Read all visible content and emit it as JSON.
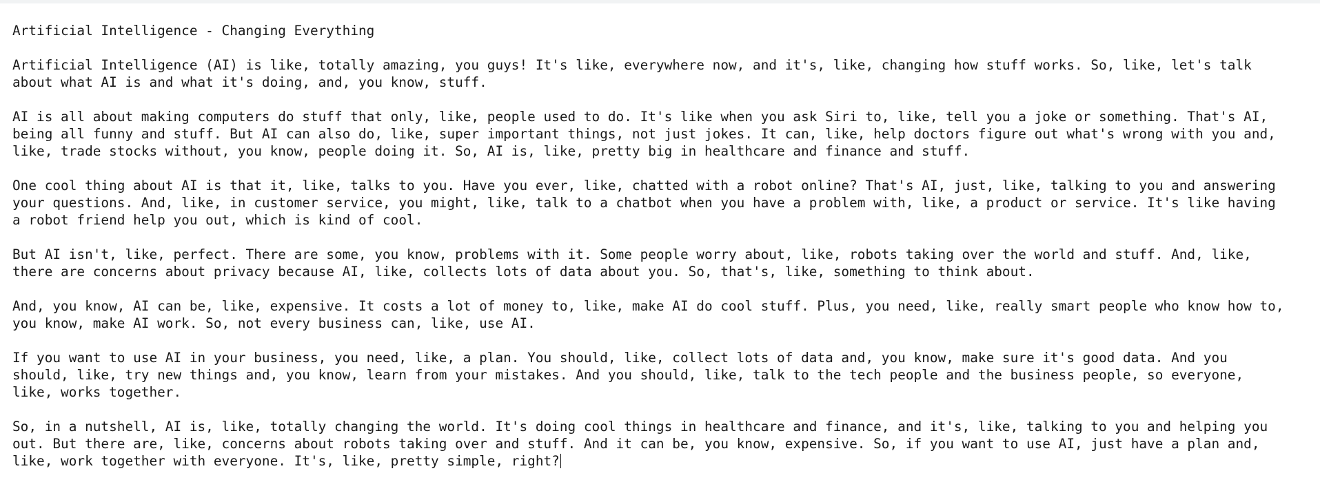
{
  "document": {
    "lines": [
      "Artificial Intelligence - Changing Everything",
      "",
      "Artificial Intelligence (AI) is like, totally amazing, you guys! It's like, everywhere now, and it's, like, changing how stuff works. So, like, let's talk",
      "about what AI is and what it's doing, and, you know, stuff.",
      "",
      "AI is all about making computers do stuff that only, like, people used to do. It's like when you ask Siri to, like, tell you a joke or something. That's AI,",
      "being all funny and stuff. But AI can also do, like, super important things, not just jokes. It can, like, help doctors figure out what's wrong with you and,",
      "like, trade stocks without, you know, people doing it. So, AI is, like, pretty big in healthcare and finance and stuff.",
      "",
      "One cool thing about AI is that it, like, talks to you. Have you ever, like, chatted with a robot online? That's AI, just, like, talking to you and answering",
      "your questions. And, like, in customer service, you might, like, talk to a chatbot when you have a problem with, like, a product or service. It's like having",
      "a robot friend help you out, which is kind of cool.",
      "",
      "But AI isn't, like, perfect. There are some, you know, problems with it. Some people worry about, like, robots taking over the world and stuff. And, like,",
      "there are concerns about privacy because AI, like, collects lots of data about you. So, that's, like, something to think about.",
      "",
      "And, you know, AI can be, like, expensive. It costs a lot of money to, like, make AI do cool stuff. Plus, you need, like, really smart people who know how to,",
      "you know, make AI work. So, not every business can, like, use AI.",
      "",
      "If you want to use AI in your business, you need, like, a plan. You should, like, collect lots of data and, you know, make sure it's good data. And you",
      "should, like, try new things and, you know, learn from your mistakes. And you should, like, talk to the tech people and the business people, so everyone,",
      "like, works together.",
      "",
      "So, in a nutshell, AI is, like, totally changing the world. It's doing cool things in healthcare and finance, and it's, like, talking to you and helping you",
      "out. But there are, like, concerns about robots taking over and stuff. And it can be, you know, expensive. So, if you want to use AI, just have a plan and,",
      "like, work together with everyone. It's, like, pretty simple, right?"
    ]
  }
}
